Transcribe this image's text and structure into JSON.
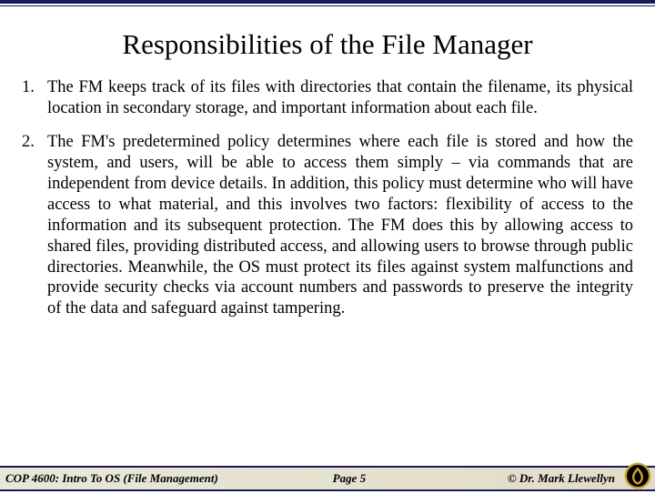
{
  "title": "Responsibilities of the File Manager",
  "items": [
    {
      "num": "1.",
      "text": "The FM keeps track of its files with directories that contain the filename, its physical location in secondary storage, and important information about each file."
    },
    {
      "num": "2.",
      "text": "The FM's predetermined policy determines where each file is stored and how the system, and users, will be able to access them simply – via commands that are independent from device details.  In addition, this policy must determine who will have access to what material, and this involves two factors: flexibility of access to the information and its subsequent protection.  The FM does this by allowing access to shared files, providing distributed access, and allowing users to browse through public directories.  Meanwhile, the OS must protect its files against system malfunctions and provide security checks via account numbers and passwords to preserve the integrity of the data and safeguard against tampering."
    }
  ],
  "footer": {
    "left": "COP 4600: Intro To OS  (File Management)",
    "mid": "Page 5",
    "right": "© Dr. Mark Llewellyn"
  }
}
